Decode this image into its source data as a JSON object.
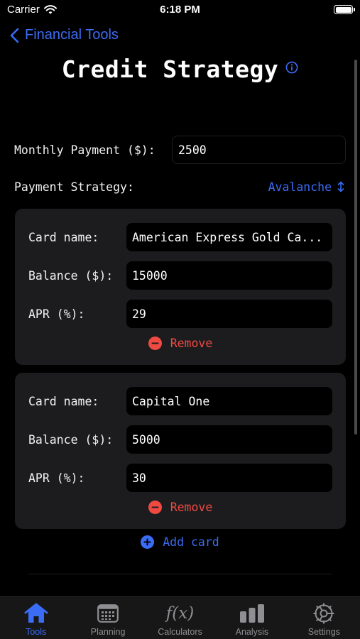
{
  "status_bar": {
    "carrier": "Carrier",
    "time": "6:18 PM"
  },
  "nav": {
    "back_label": "Financial Tools",
    "title": "Credit Strategy"
  },
  "form": {
    "monthly_payment_label": "Monthly Payment ($):",
    "monthly_payment_value": "2500",
    "strategy_label": "Payment Strategy:",
    "strategy_value": "Avalanche"
  },
  "cards": [
    {
      "name_label": "Card name:",
      "name_value": "American Express Gold Ca...",
      "balance_label": "Balance ($):",
      "balance_value": "15000",
      "apr_label": "APR (%):",
      "apr_value": "29",
      "remove_label": "Remove"
    },
    {
      "name_label": "Card name:",
      "name_value": "Capital One",
      "balance_label": "Balance ($):",
      "balance_value": "5000",
      "apr_label": "APR (%):",
      "apr_value": "30",
      "remove_label": "Remove"
    }
  ],
  "add_card_label": "Add card",
  "tabs": [
    {
      "label": "Tools",
      "icon": "house-icon",
      "active": true
    },
    {
      "label": "Planning",
      "icon": "calendar-icon",
      "active": false
    },
    {
      "label": "Calculators",
      "icon": "function-icon",
      "glyph": "f(x)",
      "active": false
    },
    {
      "label": "Analysis",
      "icon": "bar-chart-icon",
      "active": false
    },
    {
      "label": "Settings",
      "icon": "gear-icon",
      "active": false
    }
  ],
  "colors": {
    "accent": "#3b6cf6",
    "destructive": "#ef4a42",
    "card_background": "#1c1c1e",
    "tab_inactive": "#8e8e93"
  }
}
